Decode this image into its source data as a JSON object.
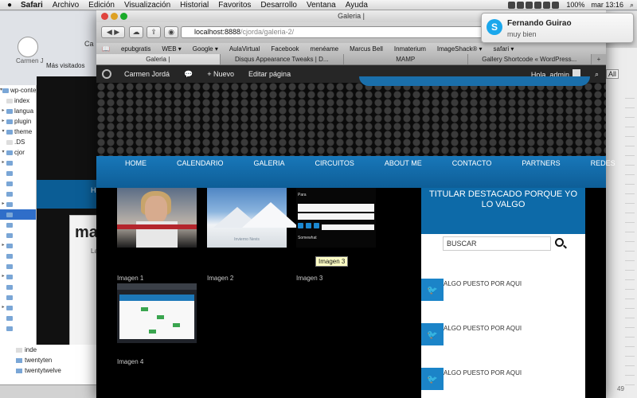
{
  "menubar": {
    "items": [
      "Safari",
      "Archivo",
      "Edición",
      "Visualización",
      "Historial",
      "Favoritos",
      "Desarrollo",
      "Ventana",
      "Ayuda"
    ],
    "battery": "100%",
    "clock": "mar 13:16"
  },
  "notification": {
    "sender": "Fernando Guirao",
    "message": "muy bien"
  },
  "background": {
    "big_heading": "ma",
    "small_label": "La",
    "blue_text": "HO",
    "mini_label": "Ca",
    "mini_name": "Carmen J",
    "mini_small": "Má",
    "all_button": "All",
    "footer_count": "49 ",
    "tree": [
      "wp-conte",
      "index",
      "langua",
      "plugin",
      "theme",
      ".DS",
      "cjor",
      "",
      "",
      "",
      "",
      "",
      "",
      "",
      "",
      "",
      "",
      "",
      "",
      "",
      "",
      "",
      ""
    ],
    "tree_bottom": [
      "inde",
      "twentyten",
      "twentytwelve"
    ]
  },
  "browser": {
    "title": "Galeria |",
    "bg_title": "Ca",
    "url_host": "localhost:8888",
    "url_path": "/cjorda/galeria-2/",
    "bookmarks": [
      "epubgratis",
      "WEB ▾",
      "Google ▾",
      "AulaVirtual",
      "Facebook",
      "menéame",
      "Marcus Bell",
      "Inmaterium",
      "ImageShack® ▾",
      "safari ▾"
    ],
    "bg_bookmark": "Más visitados",
    "tabs": [
      "Galeria |",
      "Disqus Appearance Tweaks | D...",
      "MAMP",
      "Gallery Shortcode « WordPress..."
    ]
  },
  "adminbar": {
    "site": "Carmen Jordá",
    "new": "Nuevo",
    "edit": "Editar página",
    "greeting": "Hola, admin"
  },
  "nav": [
    "HOME",
    "CALENDARIO",
    "GALERIA",
    "CIRCUITOS",
    "ABOUT ME",
    "CONTACTO",
    "PARTNERS",
    "REDES"
  ],
  "gallery": {
    "items": [
      {
        "label": "Imagen 1"
      },
      {
        "label": "Imagen 2"
      },
      {
        "label": "Imagen 3"
      },
      {
        "label": "Imagen 4"
      }
    ],
    "tooltip": "Imagen 3",
    "thumb2_caption": "Invierno Nevis"
  },
  "sidebar": {
    "title": "TITULAR DESTACADO PORQUE YO LO VALGO",
    "search_placeholder": "BUSCAR",
    "tweets": [
      "ALGO PUESTO POR AQUI",
      "ALGO PUESTO POR AQUI",
      "ALGO PUESTO POR AQUI"
    ]
  },
  "colors": {
    "accent": "#1877b9",
    "admin_bar": "#262626",
    "twitter": "#1b84c8"
  }
}
